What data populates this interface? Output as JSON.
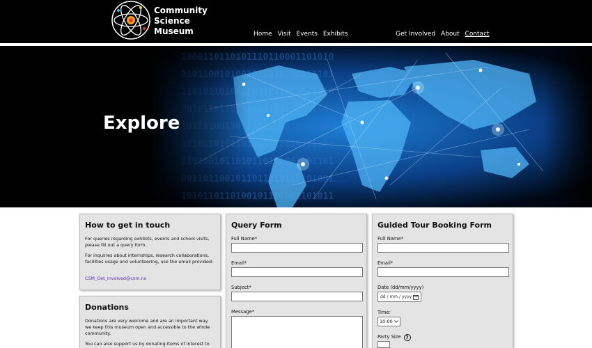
{
  "brand": {
    "name_line1": "Community",
    "name_line2": "Science",
    "name_line3": "Museum"
  },
  "nav": {
    "left": [
      "Home",
      "Visit",
      "Events",
      "Exhibits"
    ],
    "right": [
      "Get Involved",
      "About",
      "Contact"
    ],
    "active": "Contact"
  },
  "hero": {
    "title": "Explore"
  },
  "contact_panel": {
    "heading": "How to get in touch",
    "para1": "For queries regarding exhibits, events and school visits, please fill out a query form.",
    "para2": "For inquiries about internships, research collaborations, facilities usage and volunteering, use the email provided:",
    "email": "CSM_Get_Involved@csm.no"
  },
  "donations_panel": {
    "heading": "Donations",
    "para1": "Donations are very welcome and are an important way we keep this museum open and accessible to the whole community.",
    "para2": "You can also support us by donating items of interest to the"
  },
  "query_form": {
    "heading": "Query Form",
    "full_name_label": "Full Name*",
    "email_label": "Email*",
    "subject_label": "Subject*",
    "message_label": "Message*"
  },
  "tour_form": {
    "heading": "Guided Tour Booking Form",
    "full_name_label": "Full Name*",
    "email_label": "Email*",
    "date_label": "Date (dd/mm/yyyy)",
    "date_placeholder": "dd / mm / yyyy",
    "time_label": "Time:",
    "time_value": "10:00",
    "party_label": "Party Size"
  },
  "colors": {
    "header_bg": "#000000",
    "panel_bg": "#e4e4e4",
    "link": "#5a2ab7"
  }
}
